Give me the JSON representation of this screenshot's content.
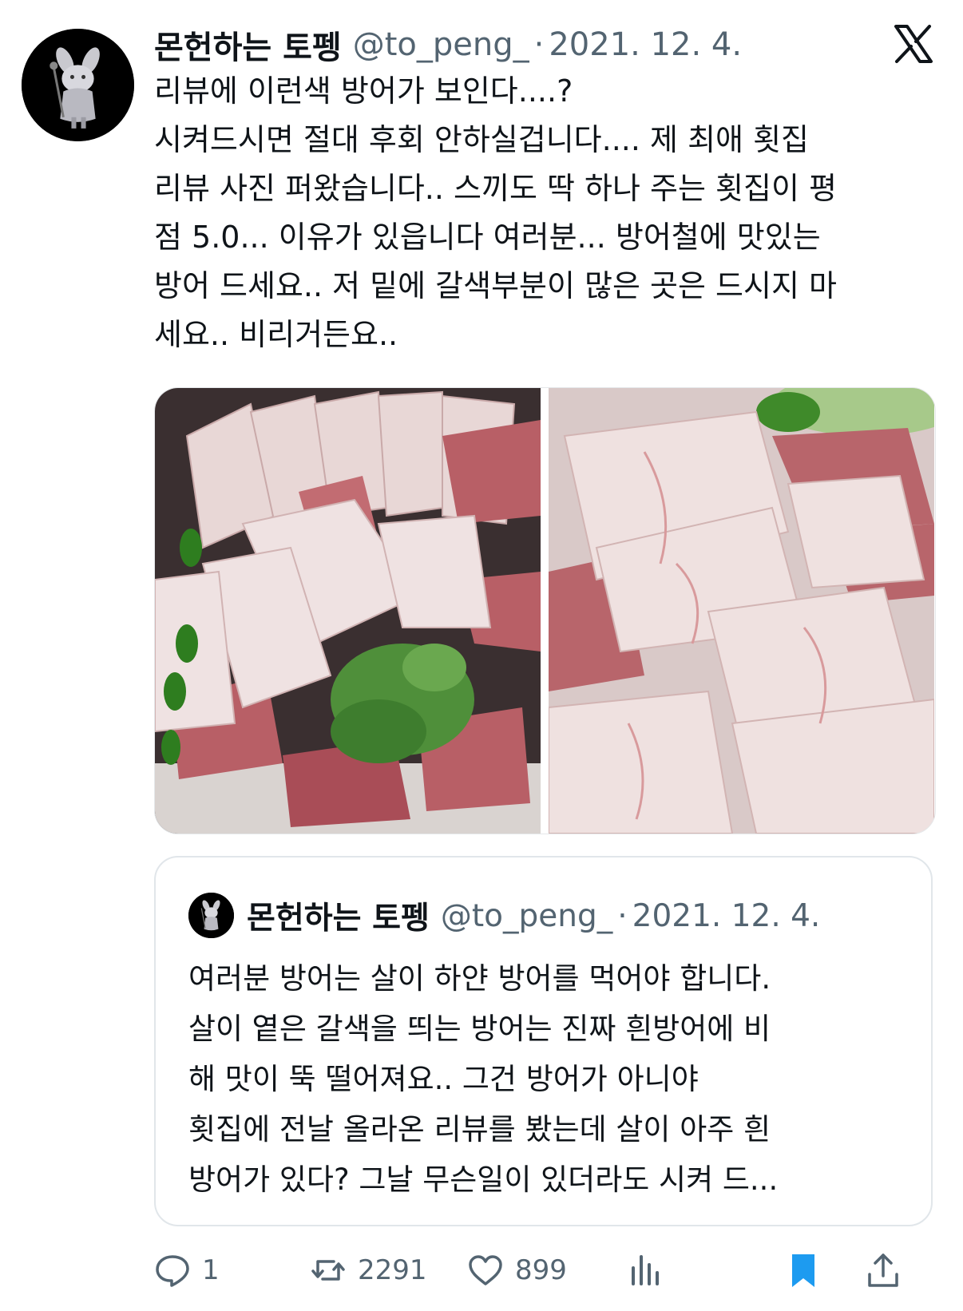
{
  "tweet": {
    "author": {
      "display_name": "몬헌하는 토펭",
      "handle": "@to_peng_",
      "avatar_icon": "avatar-icon"
    },
    "separator": "·",
    "date": "2021. 12. 4.",
    "platform_icon": "x-logo-icon",
    "text_lines": [
      "리뷰에 이런색 방어가 보인다....?",
      "시켜드시면 절대 후회 안하실겁니다.... 제 최애 횟집",
      "리뷰 사진 퍼왔습니다.. 스끼도 딱 하나 주는 횟집이 평",
      "점 5.0... 이유가 있읍니다 여러분... 방어철에 맛있는",
      "방어 드세요.. 저 밑에 갈색부분이 많은 곳은 드시지 마",
      "세요.. 비리거든요.."
    ],
    "media": [
      {
        "description": "sashimi-platter-photo"
      },
      {
        "description": "sashimi-closeup-photo"
      }
    ]
  },
  "quote": {
    "author": {
      "display_name": "몬헌하는 토펭",
      "handle": "@to_peng_"
    },
    "separator": "·",
    "date": "2021. 12. 4.",
    "text_lines": [
      "여러분 방어는 살이 하얀 방어를 먹어야 합니다.",
      "살이 옅은 갈색을 띄는 방어는 진짜 흰방어에 비",
      "해 맛이 뚝 떨어져요.. 그건 방어가 아니야",
      "횟집에 전날 올라온 리뷰를 봤는데 살이 아주 흰",
      "방어가 있다? 그날 무슨일이 있더라도 시켜 드..."
    ]
  },
  "actions": {
    "reply": {
      "icon": "reply-icon",
      "count": "1"
    },
    "retweet": {
      "icon": "retweet-icon",
      "count": "2291"
    },
    "like": {
      "icon": "heart-icon",
      "count": "899"
    },
    "views": {
      "icon": "views-icon"
    },
    "bookmark": {
      "icon": "bookmark-icon",
      "color": "#1d9bf0"
    },
    "share": {
      "icon": "share-icon"
    }
  },
  "colors": {
    "text_primary": "#0f1419",
    "text_secondary": "#536471",
    "accent": "#1d9bf0",
    "border": "#e1e6ea"
  }
}
